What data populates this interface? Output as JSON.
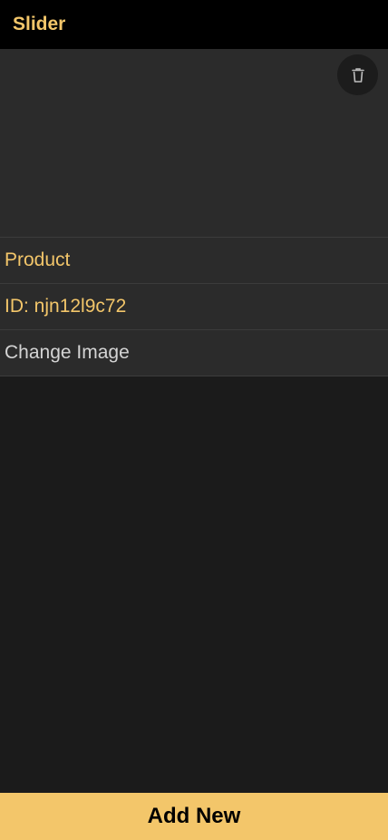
{
  "header": {
    "title": "Slider"
  },
  "item": {
    "name": "Product",
    "id_text": "ID: njn12l9c72",
    "change_image_label": "Change Image",
    "delete_icon": "trash-icon"
  },
  "footer": {
    "add_label": "Add New"
  },
  "colors": {
    "accent": "#f3c66a",
    "header_bg": "#000000",
    "card_bg": "#2b2b2b",
    "page_bg": "#1b1b1b"
  }
}
